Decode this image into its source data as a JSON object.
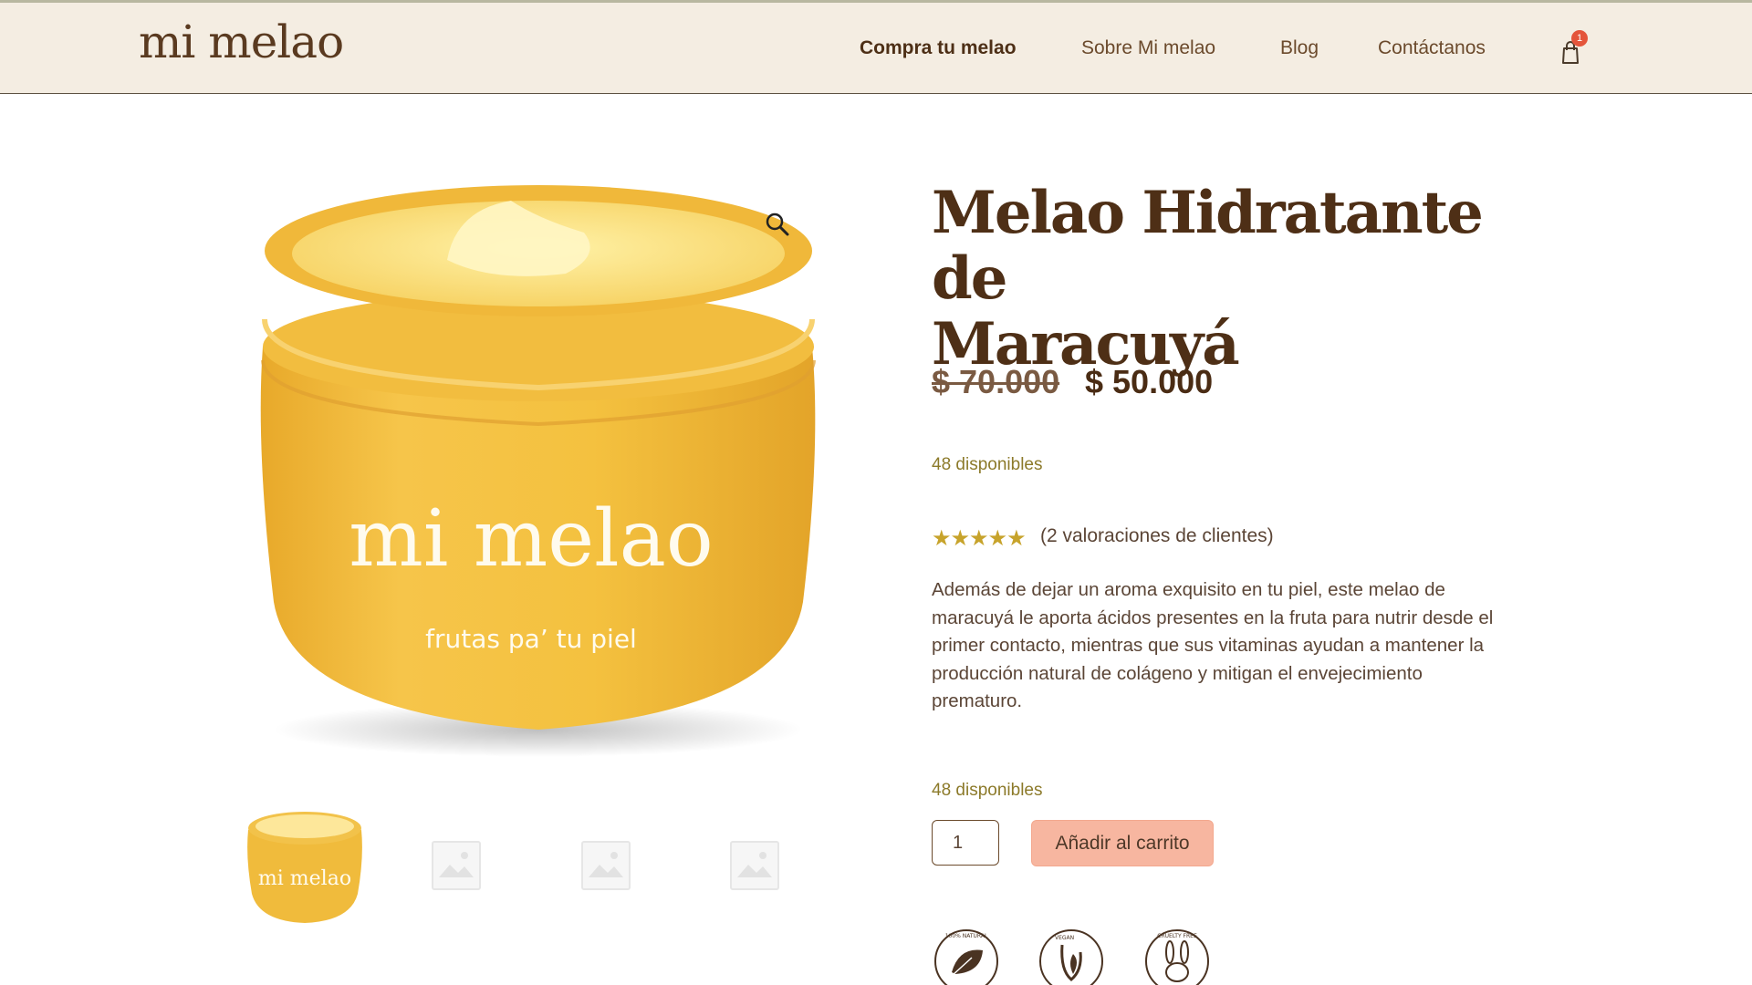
{
  "brand": {
    "logo_text": "mi melao"
  },
  "nav": {
    "items": [
      {
        "label": "Compra tu melao",
        "active": true
      },
      {
        "label": "Sobre Mi melao",
        "active": false
      },
      {
        "label": "Blog",
        "active": false
      },
      {
        "label": "Contáctanos",
        "active": false
      }
    ],
    "cart_count": "1"
  },
  "product": {
    "title_line1": "Melao Hidratante de",
    "title_line2": "Maracuyá",
    "price_old": "$ 70.000",
    "price_new": "$ 50.000",
    "stock_top": "48 disponibles",
    "rating": 5,
    "reviews_label": "(2 valoraciones de clientes)",
    "description": "Además de dejar un aroma exquisito en tu piel, este melao de maracuyá le aporta ácidos presentes en la fruta para nutrir desde el primer contacto, mientras que sus vitaminas ayudan a mantener la producción natural de colágeno y mitigan el envejecimiento prematuro.",
    "stock_bottom": "48 disponibles",
    "quantity": "1",
    "add_to_cart_label": "Añadir al carrito",
    "jar_brand": "mi melao",
    "jar_tagline": "frutas pa’ tu piel"
  },
  "badges": [
    {
      "icon": "leaf-icon",
      "text": "100% NATURAL"
    },
    {
      "icon": "vegan-icon",
      "text": "VEGAN"
    },
    {
      "icon": "bunny-icon",
      "text": "CRUELTY FREE"
    }
  ],
  "colors": {
    "header_bg": "#f4ede2",
    "brand_brown": "#4e2f16",
    "stock_olive": "#8c7a2a",
    "button_peach": "#f7b6a0",
    "jar_yellow": "#f4c542"
  }
}
